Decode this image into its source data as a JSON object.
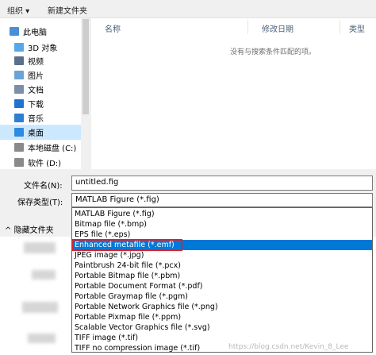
{
  "toolbar": {
    "organize": "组织 ▾",
    "new_folder": "新建文件夹"
  },
  "nav": {
    "items": [
      {
        "label": "此电脑",
        "color": "#4a8fd6"
      },
      {
        "label": "3D 对象",
        "color": "#57a8e8"
      },
      {
        "label": "视频",
        "color": "#5a6f8c"
      },
      {
        "label": "图片",
        "color": "#6aa3d8"
      },
      {
        "label": "文档",
        "color": "#7c8fa8"
      },
      {
        "label": "下载",
        "color": "#1f74d0"
      },
      {
        "label": "音乐",
        "color": "#2d7fd1"
      },
      {
        "label": "桌面",
        "color": "#2f8ae0"
      },
      {
        "label": "本地磁盘 (C:)",
        "color": "#8a8a8a"
      },
      {
        "label": "软件 (D:)",
        "color": "#8a8a8a"
      }
    ]
  },
  "files": {
    "col_name": "名称",
    "col_date": "修改日期",
    "col_type": "类型",
    "empty_message": "没有与搜索条件匹配的项。"
  },
  "form": {
    "filename_label": "文件名(N):",
    "filename_value": "untitled.fig",
    "filetype_label": "保存类型(T):",
    "filetype_value": "MATLAB Figure (*.fig)",
    "hide_folders": "隐藏文件夹"
  },
  "dropdown": {
    "options": [
      "MATLAB Figure (*.fig)",
      "Bitmap file (*.bmp)",
      "EPS file (*.eps)",
      "Enhanced metafile (*.emf)",
      "JPEG image (*.jpg)",
      "Paintbrush 24-bit file (*.pcx)",
      "Portable Bitmap file (*.pbm)",
      "Portable Document Format (*.pdf)",
      "Portable Graymap file (*.pgm)",
      "Portable Network Graphics file (*.png)",
      "Portable Pixmap file (*.ppm)",
      "Scalable Vector Graphics file (*.svg)",
      "TIFF image (*.tif)",
      "TIFF no compression image (*.tif)"
    ],
    "highlighted_index": 3
  },
  "watermark": "https://blog.csdn.net/Kevin_8_Lee",
  "colors": {
    "highlight": "#0078d7",
    "selection": "#cce8ff",
    "annotation": "#e0202a"
  }
}
